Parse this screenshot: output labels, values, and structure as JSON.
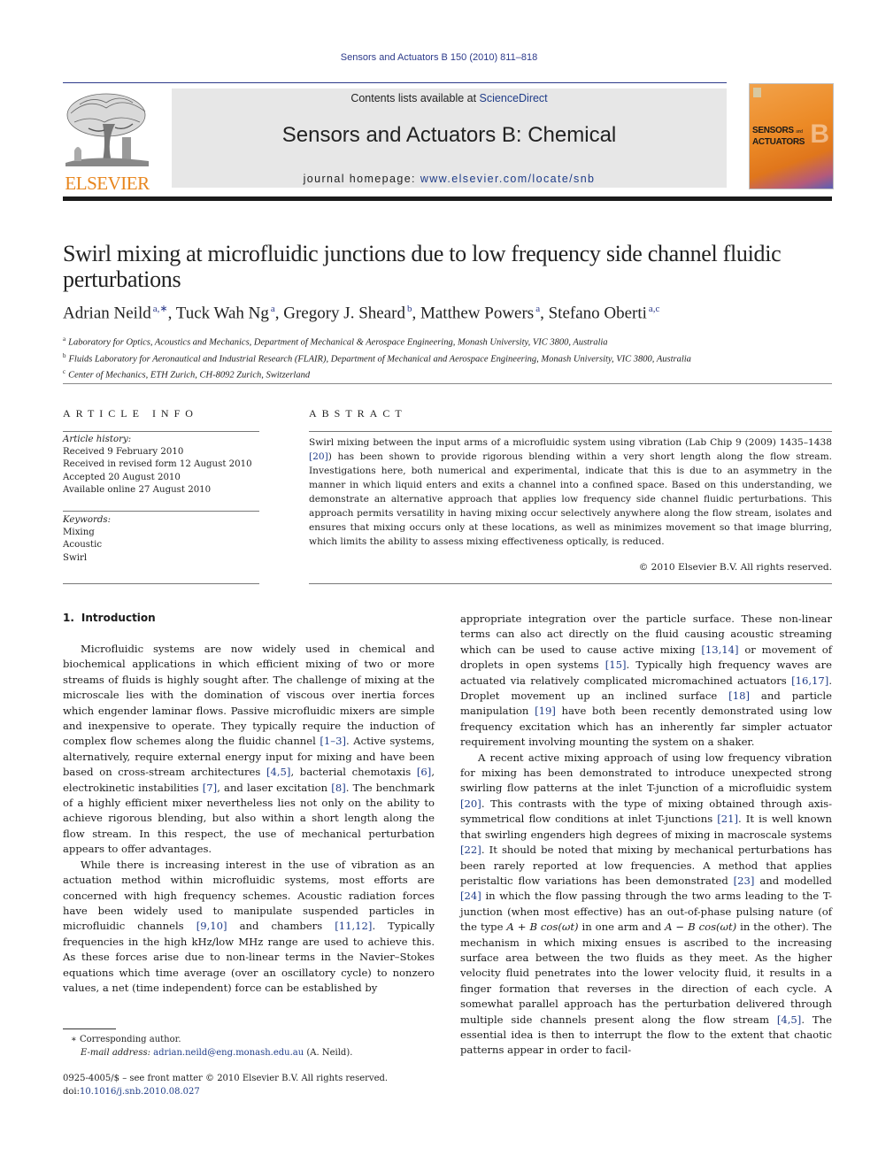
{
  "running_head": "Sensors and Actuators B 150 (2010) 811–818",
  "masthead": {
    "publisher_logo_text": "ELSEVIER",
    "contents_prefix": "Contents lists available at ",
    "contents_link": "ScienceDirect",
    "journal_name": "Sensors and Actuators B: Chemical",
    "homepage_prefix": "journal homepage: ",
    "homepage_link": "www.elsevier.com/locate/snb",
    "cover": {
      "line1": "SENSORS",
      "and": "and",
      "line2": "ACTUATORS",
      "letter": "B"
    },
    "colors": {
      "link": "#1f3c88",
      "logo_orange": "#e8861e",
      "banner_bg": "#e7e7e7"
    }
  },
  "article": {
    "title": "Swirl mixing at microfluidic junctions due to low frequency side channel fluidic perturbations",
    "authors": [
      {
        "name": "Adrian Neild",
        "sup": "a,∗",
        "sep": ", "
      },
      {
        "name": "Tuck Wah Ng",
        "sup": "a",
        "sep": ", "
      },
      {
        "name": "Gregory J. Sheard",
        "sup": "b",
        "sep": ", "
      },
      {
        "name": "Matthew Powers",
        "sup": "a",
        "sep": ", "
      },
      {
        "name": "Stefano Oberti",
        "sup": "a,c",
        "sep": ""
      }
    ],
    "affiliations": [
      {
        "mark": "a",
        "text": "Laboratory for Optics, Acoustics and Mechanics, Department of Mechanical & Aerospace Engineering, Monash University, VIC 3800, Australia"
      },
      {
        "mark": "b",
        "text": "Fluids Laboratory for Aeronautical and Industrial Research (FLAIR), Department of Mechanical and Aerospace Engineering, Monash University, VIC 3800, Australia"
      },
      {
        "mark": "c",
        "text": "Center of Mechanics, ETH Zurich, CH-8092 Zurich, Switzerland"
      }
    ]
  },
  "article_info": {
    "heading": "ARTICLE INFO",
    "history_label": "Article history:",
    "history": [
      "Received 9 February 2010",
      "Received in revised form 12 August 2010",
      "Accepted 20 August 2010",
      "Available online 27 August 2010"
    ],
    "keywords_label": "Keywords:",
    "keywords": [
      "Mixing",
      "Acoustic",
      "Swirl"
    ]
  },
  "abstract": {
    "heading": "ABSTRACT",
    "text_before_ref": "Swirl mixing between the input arms of a microfluidic system using vibration (Lab Chip 9 (2009) 1435–1438 ",
    "ref": "[20]",
    "text_after_ref": ") has been shown to provide rigorous blending within a very short length along the flow stream. Investigations here, both numerical and experimental, indicate that this is due to an asymmetry in the manner in which liquid enters and exits a channel into a confined space. Based on this understanding, we demonstrate an alternative approach that applies low frequency side channel fluidic perturbations. This approach permits versatility in having mixing occur selectively anywhere along the flow stream, isolates and ensures that mixing occurs only at these locations, as well as minimizes movement so that image blurring, which limits the ability to assess mixing effectiveness optically, is reduced.",
    "copyright": "© 2010 Elsevier B.V. All rights reserved."
  },
  "body": {
    "section_number": "1.",
    "section_title": "Introduction",
    "left": {
      "p1": [
        {
          "t": "Microfluidic systems are now widely used in chemical and biochemical applications in which efficient mixing of two or more streams of fluids is highly sought after. The challenge of mixing at the microscale lies with the domination of viscous over inertia forces which engender laminar flows. Passive microfluidic mixers are simple and inexpensive to operate. They typically require the induction of complex flow schemes along the fluidic channel "
        },
        {
          "r": "[1–3]"
        },
        {
          "t": ". Active systems, alternatively, require external energy input for mixing and have been based on cross-stream architectures "
        },
        {
          "r": "[4,5]"
        },
        {
          "t": ", bacterial chemotaxis "
        },
        {
          "r": "[6]"
        },
        {
          "t": ", electrokinetic instabilities "
        },
        {
          "r": "[7]"
        },
        {
          "t": ", and laser excitation "
        },
        {
          "r": "[8]"
        },
        {
          "t": ". The benchmark of a highly efficient mixer nevertheless lies not only on the ability to achieve rigorous blending, but also within a short length along the flow stream. In this respect, the use of mechanical perturbation appears to offer advantages."
        }
      ],
      "p2": [
        {
          "t": "While there is increasing interest in the use of vibration as an actuation method within microfluidic systems, most efforts are concerned with high frequency schemes. Acoustic radiation forces have been widely used to manipulate suspended particles in microfluidic channels "
        },
        {
          "r": "[9,10]"
        },
        {
          "t": " and chambers "
        },
        {
          "r": "[11,12]"
        },
        {
          "t": ". Typically frequencies in the high kHz/low MHz range are used to achieve this. As these forces arise due to non-linear terms in the Navier–Stokes equations which time average (over an oscillatory cycle) to nonzero values, a net (time independent) force can be established by"
        }
      ]
    },
    "right": {
      "p1": [
        {
          "t": "appropriate integration over the particle surface. These non-linear terms can also act directly on the fluid causing acoustic streaming which can be used to cause active mixing "
        },
        {
          "r": "[13,14]"
        },
        {
          "t": " or movement of droplets in open systems "
        },
        {
          "r": "[15]"
        },
        {
          "t": ". Typically high frequency waves are actuated via relatively complicated micromachined actuators "
        },
        {
          "r": "[16,17]"
        },
        {
          "t": ". Droplet movement up an inclined surface "
        },
        {
          "r": "[18]"
        },
        {
          "t": " and particle manipulation "
        },
        {
          "r": "[19]"
        },
        {
          "t": " have both been recently demonstrated using low frequency excitation which has an inherently far simpler actuator requirement involving mounting the system on a shaker."
        }
      ],
      "p2": [
        {
          "t": "A recent active mixing approach of using low frequency vibration for mixing has been demonstrated to introduce unexpected strong swirling flow patterns at the inlet T-junction of a microfluidic system "
        },
        {
          "r": "[20]"
        },
        {
          "t": ". This contrasts with the type of mixing obtained through axis-symmetrical flow conditions at inlet T-junctions "
        },
        {
          "r": "[21]"
        },
        {
          "t": ". It is well known that swirling engenders high degrees of mixing in macroscale systems "
        },
        {
          "r": "[22]"
        },
        {
          "t": ". It should be noted that mixing by mechanical perturbations has been rarely reported at low frequencies. A method that applies peristaltic flow variations has been demonstrated "
        },
        {
          "r": "[23]"
        },
        {
          "t": " and modelled "
        },
        {
          "r": "[24]"
        },
        {
          "t": " in which the flow passing through the two arms leading to the T-junction (when most effective) has an out-of-phase pulsing nature (of the type "
        },
        {
          "m": "A + B cos(ωt)"
        },
        {
          "t": " in one arm and "
        },
        {
          "m": "A − B cos(ωt)"
        },
        {
          "t": " in the other). The mechanism in which mixing ensues is ascribed to the increasing surface area between the two fluids as they meet. As the higher velocity fluid penetrates into the lower velocity fluid, it results in a finger formation that reverses in the direction of each cycle. A somewhat parallel approach has the perturbation delivered through multiple side channels present along the flow stream "
        },
        {
          "r": "[4,5]"
        },
        {
          "t": ". The essential idea is then to interrupt the flow to the extent that chaotic patterns appear in order to facil-"
        }
      ]
    }
  },
  "footnotes": {
    "corresponding_mark": "∗",
    "corresponding_text": "Corresponding author.",
    "email_label": "E-mail address: ",
    "email": "adrian.neild@eng.monash.edu.au",
    "email_suffix": " (A. Neild).",
    "front_matter": "0925-4005/$ – see front matter © 2010 Elsevier B.V. All rights reserved.",
    "doi_prefix": "doi:",
    "doi": "10.1016/j.snb.2010.08.027"
  }
}
